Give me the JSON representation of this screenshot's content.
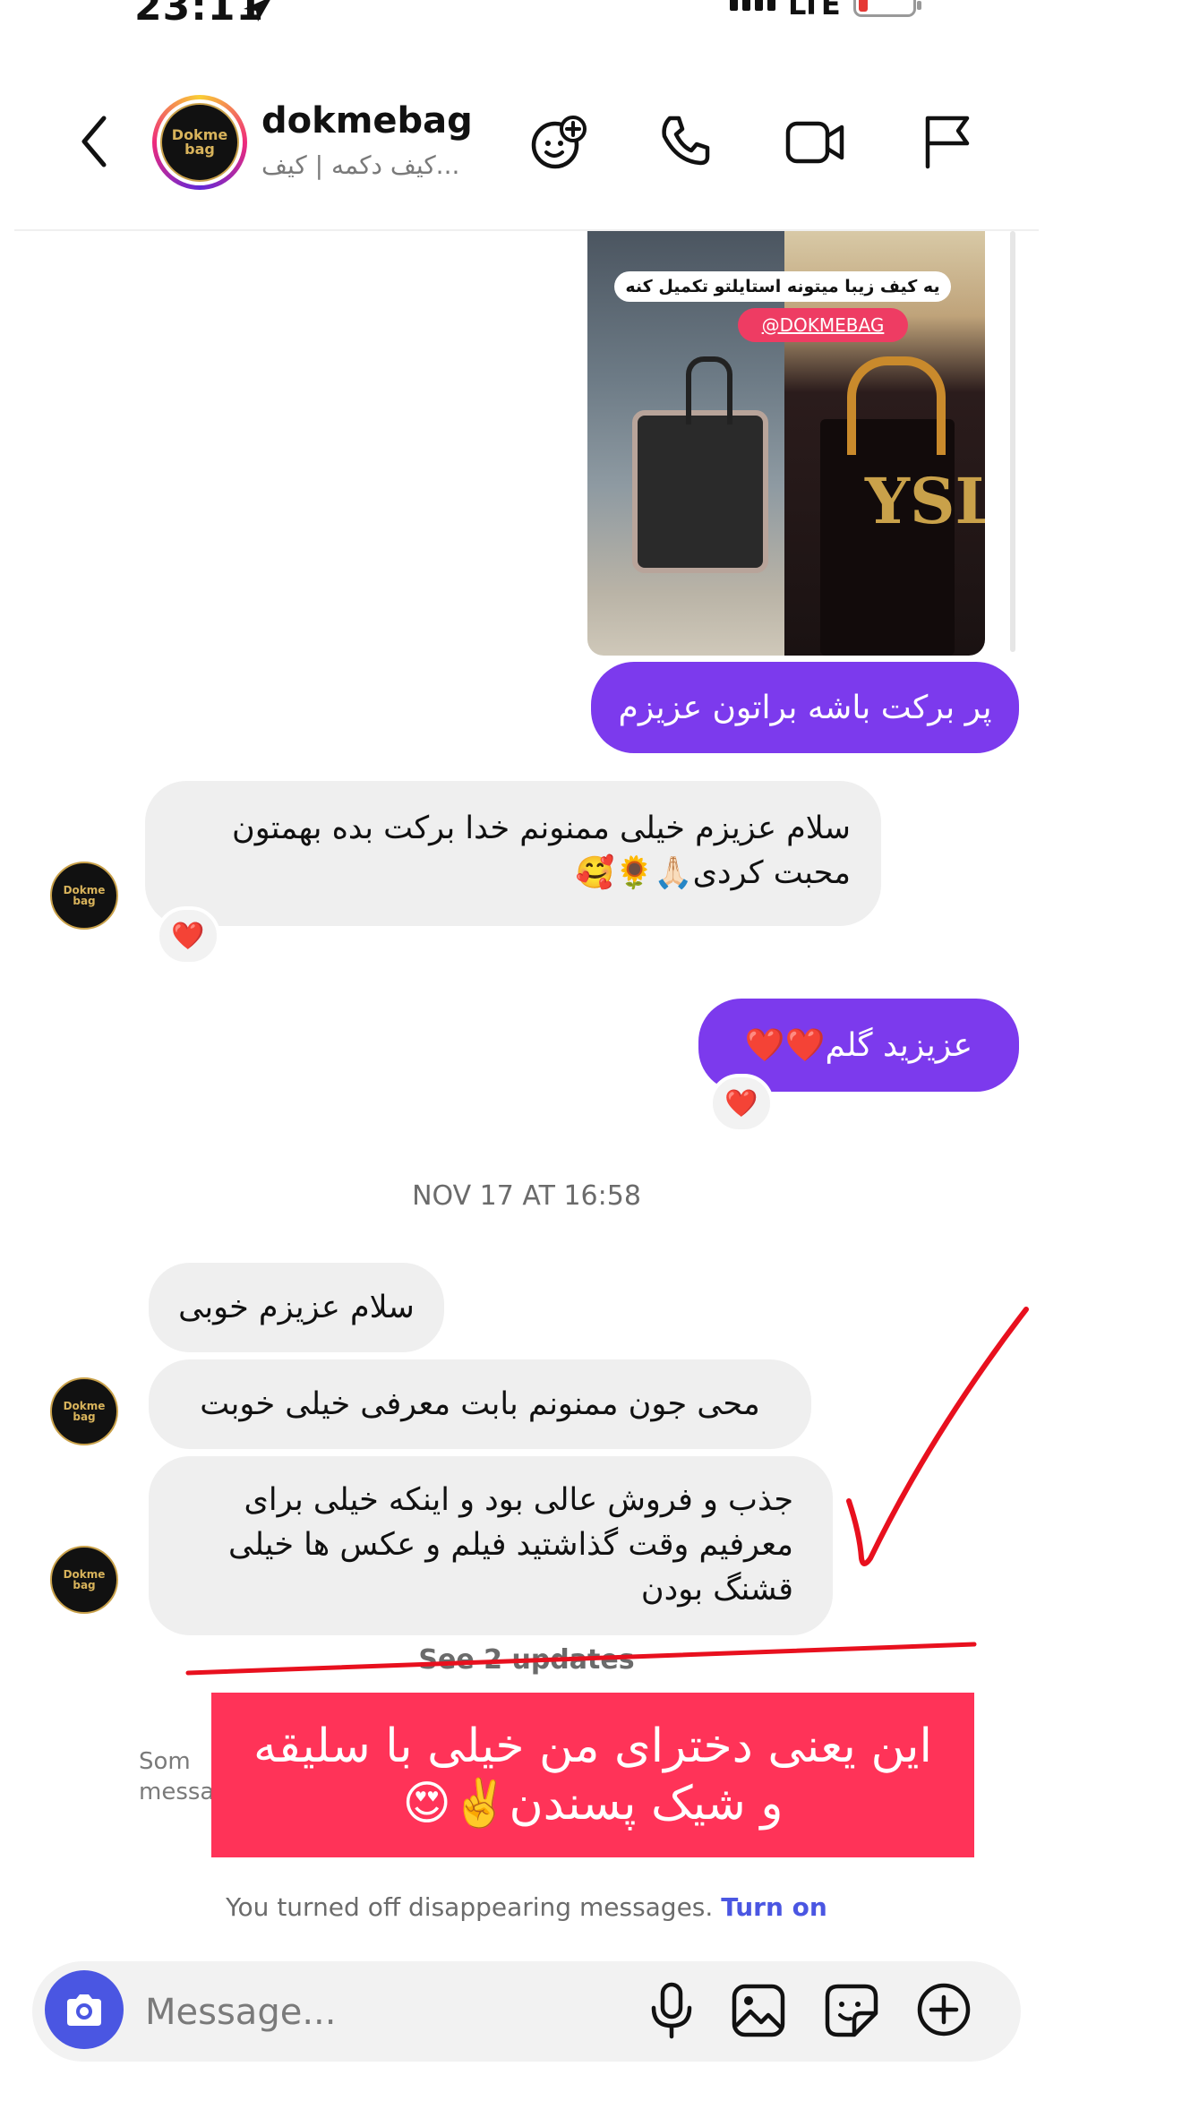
{
  "status_bar": {
    "time": "23:11",
    "network": "LTE",
    "icons": [
      "location-arrow-icon",
      "signal-icon",
      "battery-icon"
    ]
  },
  "header": {
    "title": "dokmebag",
    "subtitle": "کیف دکمه | کیف...",
    "avatar_text": "Dokme bag",
    "icons": [
      "back-icon",
      "effects-icon",
      "phone-icon",
      "video-icon",
      "flag-icon"
    ]
  },
  "media": {
    "caption": "یه کیف زیبا میتونه استایلتو تکمیل کنه 🤌😍",
    "tag": "@DOKMEBAG"
  },
  "messages": [
    {
      "id": "m1",
      "direction": "out",
      "text": "پر برکت باشه براتون عزیزم"
    },
    {
      "id": "m2",
      "direction": "in",
      "text": "سلام عزیزم خیلی ممنونم خدا برکت بده بهمتون محبت کردی🙏🏻🌻🥰",
      "reaction": "❤️"
    },
    {
      "id": "m3",
      "direction": "out",
      "text": "عزیزید گلم❤️❤️",
      "reaction": "❤️"
    },
    {
      "id": "m4",
      "direction": "in",
      "text": "سلام عزیزم خوبی"
    },
    {
      "id": "m5",
      "direction": "in",
      "text": "محی جون ممنونم بابت معرفی خیلی خوبت"
    },
    {
      "id": "m6",
      "direction": "in",
      "text": "جذب و فروش عالی بود و اینکه خیلی برای معرفیم وقت گذاشتید فیلم و عکس ها خیلی قشنگ بودن"
    }
  ],
  "date_separator": "NOV 17 AT 16:58",
  "see_updates": "See 2 updates",
  "hidden_note": {
    "line1": "Som",
    "line2": "messa"
  },
  "overlay_text": "این یعنی دخترای من خیلی با سلیقه و شیک پسندن✌️😍",
  "disappearing": {
    "text": "You turned off disappearing messages.",
    "link": "Turn on"
  },
  "composer": {
    "placeholder": "Message...",
    "icons": [
      "camera-icon",
      "mic-icon",
      "gallery-icon",
      "sticker-icon",
      "plus-icon"
    ]
  },
  "colors": {
    "outgoing_bubble": "#7c3aed",
    "incoming_bubble": "#efefef",
    "accent_blue": "#4a56e2",
    "annotation_red": "#ff3358"
  }
}
